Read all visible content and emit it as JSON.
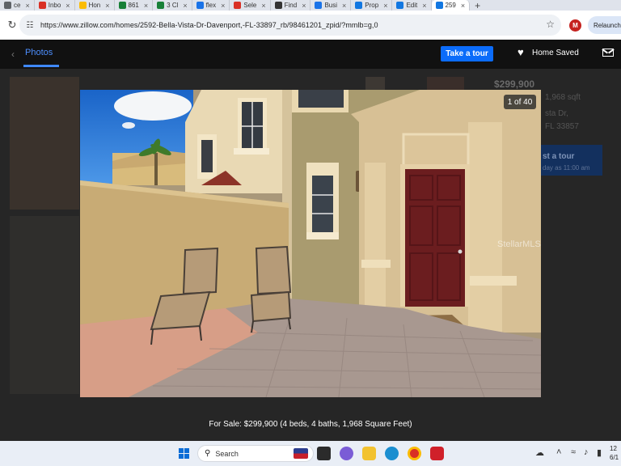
{
  "browser": {
    "tabs": [
      {
        "label": "ce",
        "color": "#5f6368"
      },
      {
        "label": "Inbo",
        "color": "#d93025"
      },
      {
        "label": "Hon",
        "color": "#fbbc04"
      },
      {
        "label": "861",
        "color": "#188038"
      },
      {
        "label": "3 Cl",
        "color": "#188038"
      },
      {
        "label": "flex",
        "color": "#1a73e8"
      },
      {
        "label": "Sele",
        "color": "#d93025"
      },
      {
        "label": "Find",
        "color": "#333333"
      },
      {
        "label": "Busi",
        "color": "#1a73e8"
      },
      {
        "label": "Prop",
        "color": "#1277e1"
      },
      {
        "label": "Edit",
        "color": "#1277e1"
      },
      {
        "label": "259",
        "color": "#1277e1"
      }
    ],
    "new_tab": "+",
    "url": "https://www.zillow.com/homes/2592-Bella-Vista-Dr-Davenport,-FL-33897_rb/98461201_zpid/?mmlb=g,0",
    "profile_initial": "M",
    "relaunch_label": "Relaunch t"
  },
  "viewer": {
    "photos_tab": "Photos",
    "take_tour": "Take a tour",
    "home_saved": "Home Saved",
    "counter": "1 of 40",
    "caption": "For Sale: $299,900 (4 beds, 4 baths, 1,968 Square Feet)",
    "watermark": "StellarMLS",
    "background": {
      "price": "$299,900",
      "sqft": "1,968 sqft",
      "street": "sta Dr,",
      "city": "FL 33857",
      "tour": "st a tour",
      "tour_sub": "day as 11:00 am"
    }
  },
  "taskbar": {
    "search_label": "Search",
    "clock_time": "12",
    "clock_date": "6/1"
  }
}
